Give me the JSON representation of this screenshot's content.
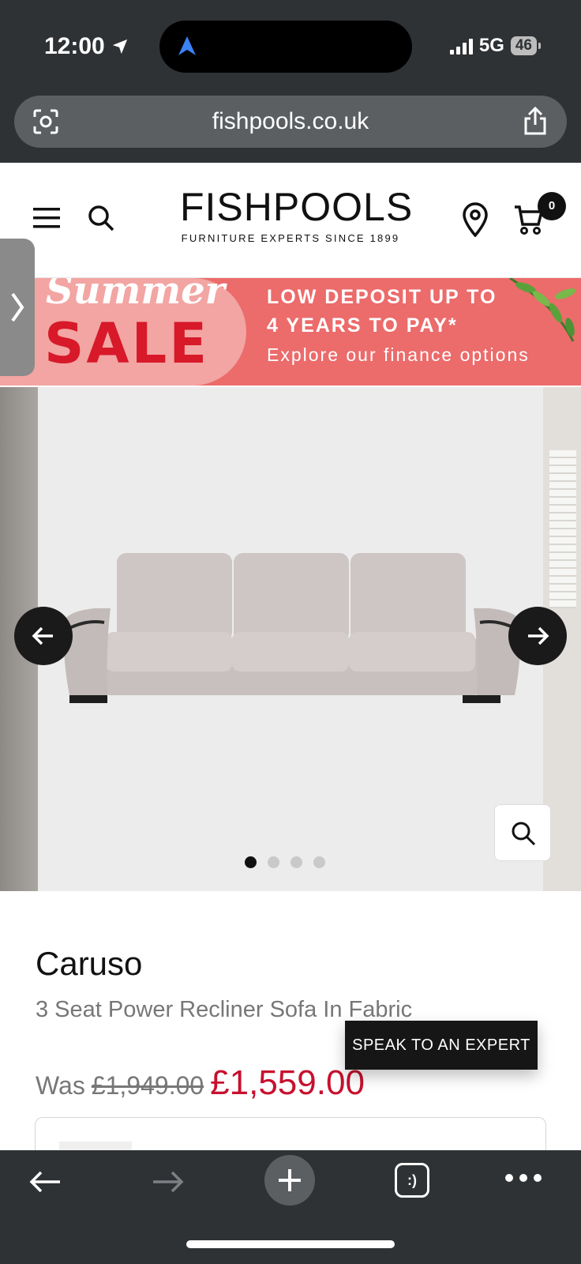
{
  "status_bar": {
    "time": "12:00",
    "network": "5G",
    "battery": "46"
  },
  "browser": {
    "url": "fishpools.co.uk"
  },
  "header": {
    "logo": "FISHPOOLS",
    "tagline": "FURNITURE EXPERTS SINCE 1899",
    "cart_count": "0"
  },
  "banner": {
    "summer": "Summer",
    "sale": "SALE",
    "line1": "LOW DEPOSIT UP TO",
    "line2": "4 YEARS TO PAY*",
    "line3": "Explore our finance options"
  },
  "carousel": {
    "slide_count": 4,
    "active_index": 0
  },
  "product": {
    "name": "Caruso",
    "subtitle": "3 Seat Power Recliner Sofa In Fabric",
    "was_label": "Was",
    "was_price": "£1,949.00",
    "price": "£1,559.00"
  },
  "cta": {
    "speak_expert": "SPEAK TO AN EXPERT"
  },
  "toolbar": {
    "tabs_glyph": ":)"
  },
  "colors": {
    "sale_red": "#d7192a",
    "price_red": "#c8102e",
    "banner_coral": "#ec6b6b",
    "chrome": "#2f3234"
  }
}
